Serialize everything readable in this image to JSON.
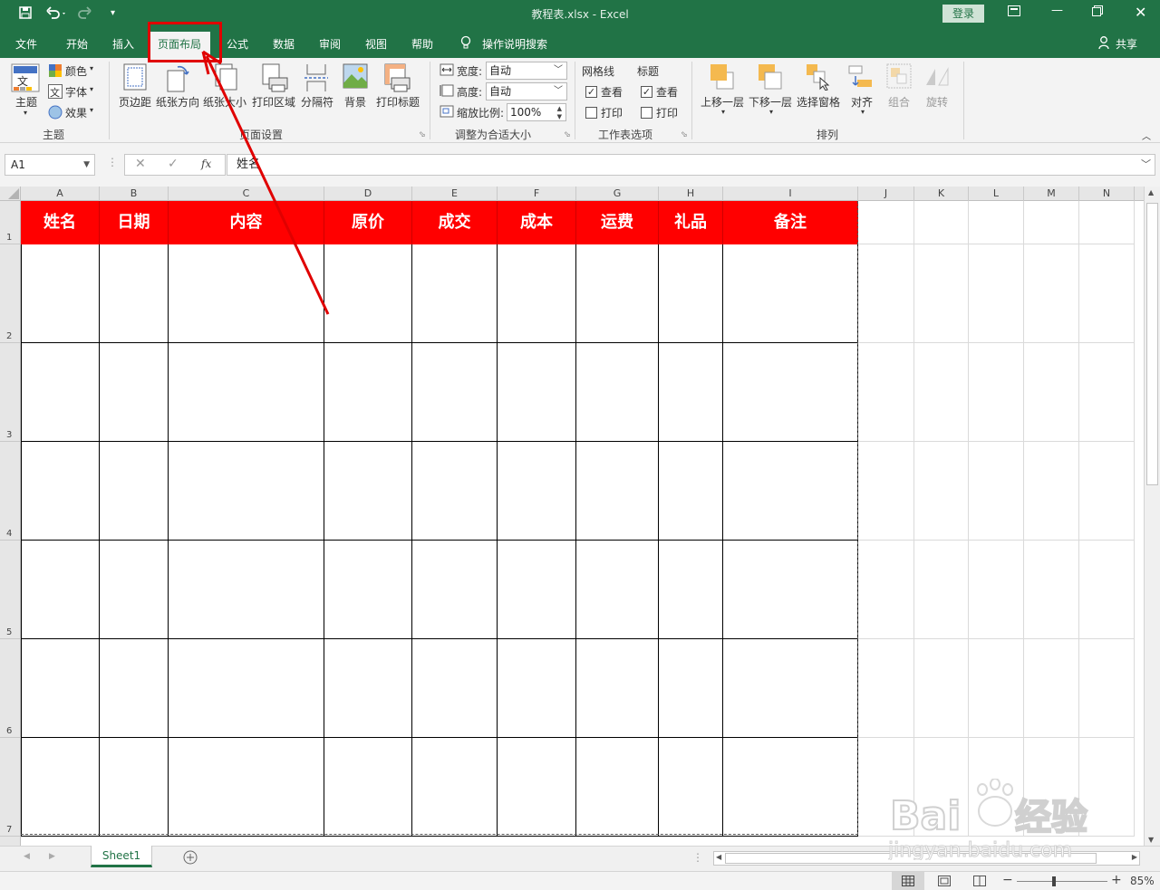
{
  "window": {
    "title": "教程表.xlsx  -  Excel",
    "login_label": "登录",
    "share_label": "共享",
    "accent_color": "#217346"
  },
  "menu": {
    "tabs": [
      "文件",
      "开始",
      "插入",
      "页面布局",
      "公式",
      "数据",
      "审阅",
      "视图",
      "帮助"
    ],
    "active_tab": "页面布局",
    "tell_me": "操作说明搜索"
  },
  "ribbon": {
    "themes": {
      "theme_label": "主题",
      "colors_label": "颜色",
      "fonts_label": "字体",
      "effects_label": "效果",
      "group_label": "主题"
    },
    "page_setup": {
      "margins_label": "页边距",
      "orientation_label": "纸张方向",
      "size_label": "纸张大小",
      "print_area_label": "打印区域",
      "breaks_label": "分隔符",
      "background_label": "背景",
      "print_titles_label": "打印标题",
      "group_label": "页面设置"
    },
    "scale": {
      "width_label": "宽度:",
      "width_value": "自动",
      "height_label": "高度:",
      "height_value": "自动",
      "scale_label": "缩放比例:",
      "scale_value": "100%",
      "group_label": "调整为合适大小"
    },
    "sheet_options": {
      "gridlines_label": "网格线",
      "headings_label": "标题",
      "view_label": "查看",
      "print_label": "打印",
      "gridlines_view_checked": true,
      "gridlines_print_checked": false,
      "headings_view_checked": true,
      "headings_print_checked": false,
      "group_label": "工作表选项"
    },
    "arrange": {
      "bring_forward_label": "上移一层",
      "send_backward_label": "下移一层",
      "selection_pane_label": "选择窗格",
      "align_label": "对齐",
      "group_obj_label": "组合",
      "rotate_label": "旋转",
      "group_label": "排列"
    }
  },
  "formula_bar": {
    "name_box": "A1",
    "fx_label": "fx",
    "content": "姓名"
  },
  "sheet": {
    "columns": [
      "A",
      "B",
      "C",
      "D",
      "E",
      "F",
      "G",
      "H",
      "I",
      "J",
      "K",
      "L",
      "M",
      "N"
    ],
    "rows": [
      "1",
      "2",
      "3",
      "4",
      "5",
      "6",
      "7"
    ],
    "headers": [
      "姓名",
      "日期",
      "内容",
      "原价",
      "成交",
      "成本",
      "运费",
      "礼品",
      "备注"
    ],
    "header_fill": "#ff0000",
    "header_text_color": "#ffffff"
  },
  "sheet_tabs": {
    "active": "Sheet1"
  },
  "status": {
    "zoom": "85%"
  },
  "annotation": {
    "color": "#e00000"
  },
  "watermark": {
    "brand": "Bai经验",
    "url": "jingyan.baidu.com"
  }
}
